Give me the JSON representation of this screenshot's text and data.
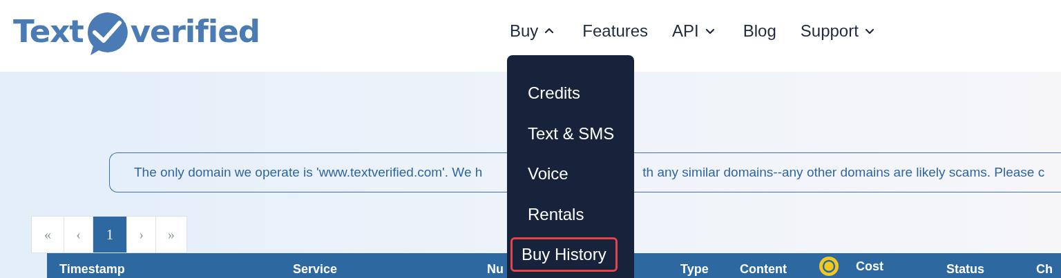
{
  "logo": {
    "text_left": "Text",
    "text_right": "verified"
  },
  "nav": [
    {
      "label": "Buy",
      "kind": "dropdown",
      "expanded": true
    },
    {
      "label": "Features",
      "kind": "link"
    },
    {
      "label": "API",
      "kind": "dropdown",
      "expanded": false
    },
    {
      "label": "Blog",
      "kind": "link"
    },
    {
      "label": "Support",
      "kind": "dropdown",
      "expanded": false
    }
  ],
  "dropdown": [
    {
      "label": "Credits",
      "highlighted": false
    },
    {
      "label": "Text & SMS",
      "highlighted": false
    },
    {
      "label": "Voice",
      "highlighted": false
    },
    {
      "label": "Rentals",
      "highlighted": false
    },
    {
      "label": "Buy History",
      "highlighted": true
    }
  ],
  "notice": {
    "text_before_menu": "The only domain we operate is 'www.textverified.com'. We h",
    "text_after_menu": "th any similar domains--any other domains are likely scams. Please c"
  },
  "pagination": [
    {
      "label": "«",
      "selected": false
    },
    {
      "label": "‹",
      "selected": false
    },
    {
      "label": "1",
      "selected": true
    },
    {
      "label": "›",
      "selected": false
    },
    {
      "label": "»",
      "selected": false
    }
  ],
  "table": {
    "columns": [
      {
        "label": "Timestamp",
        "kind": "text"
      },
      {
        "label": "Service",
        "kind": "text"
      },
      {
        "label": "Nu",
        "kind": "text"
      },
      {
        "label": "Type",
        "kind": "text"
      },
      {
        "label": "Content",
        "kind": "text"
      },
      {
        "label": "Cost",
        "kind": "coin"
      },
      {
        "label": "Status",
        "kind": "text"
      },
      {
        "label": "Ch",
        "kind": "text"
      }
    ]
  }
}
